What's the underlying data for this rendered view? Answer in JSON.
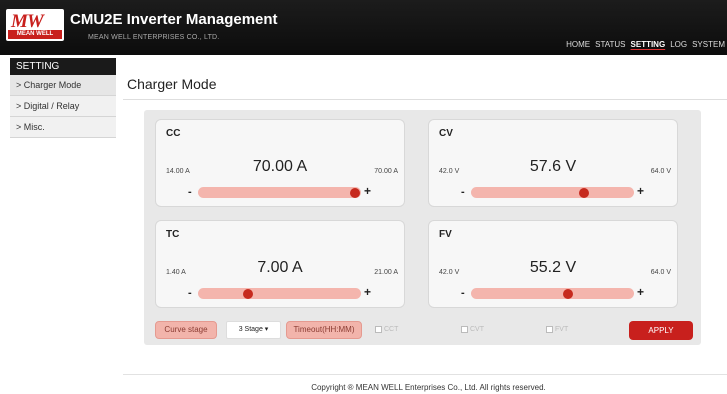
{
  "app": {
    "logo_text": "MW",
    "logo_sub": "MEAN WELL",
    "title": "CMU2E Inverter Management",
    "subtitle": "MEAN WELL ENTERPRISES CO., LTD."
  },
  "topnav": [
    "HOME",
    "STATUS",
    "SETTING",
    "LOG",
    "SYSTEM"
  ],
  "topnav_active": "SETTING",
  "sidebar": {
    "heading": "SETTING",
    "items": [
      {
        "label": "> Charger Mode"
      },
      {
        "label": "> Digital / Relay"
      },
      {
        "label": "> Misc."
      }
    ]
  },
  "page_title": "Charger Mode",
  "cards": {
    "cc": {
      "label": "CC",
      "min": "14.00 A",
      "max": "70.00 A",
      "value": "70.00 A",
      "minus": "-",
      "plus": "+",
      "level": 1.0
    },
    "cv": {
      "label": "CV",
      "min": "42.0 V",
      "max": "64.0 V",
      "value": "57.6 V",
      "minus": "-",
      "plus": "+",
      "level": 0.71
    },
    "tc": {
      "label": "TC",
      "min": "1.40 A",
      "max": "21.00 A",
      "value": "7.00 A",
      "minus": "-",
      "plus": "+",
      "level": 0.29
    },
    "fv": {
      "label": "FV",
      "min": "42.0 V",
      "max": "64.0 V",
      "value": "55.2 V",
      "minus": "-",
      "plus": "+",
      "level": 0.6
    }
  },
  "controls": {
    "curve_stage_label": "Curve stage",
    "stage_select": "3 Stage ▾",
    "timeout_label": "Timeout(HH:MM)",
    "cct_label": "CCT",
    "cvt_label": "CVT",
    "fvt_label": "FVT",
    "apply_label": "APPLY"
  },
  "footer": "Copyright ® MEAN WELL Enterprises Co., Ltd. All rights reserved.",
  "colors": {
    "accent": "#c8201d",
    "slider_track": "#f4b5ad",
    "header_bg": "#111111"
  }
}
